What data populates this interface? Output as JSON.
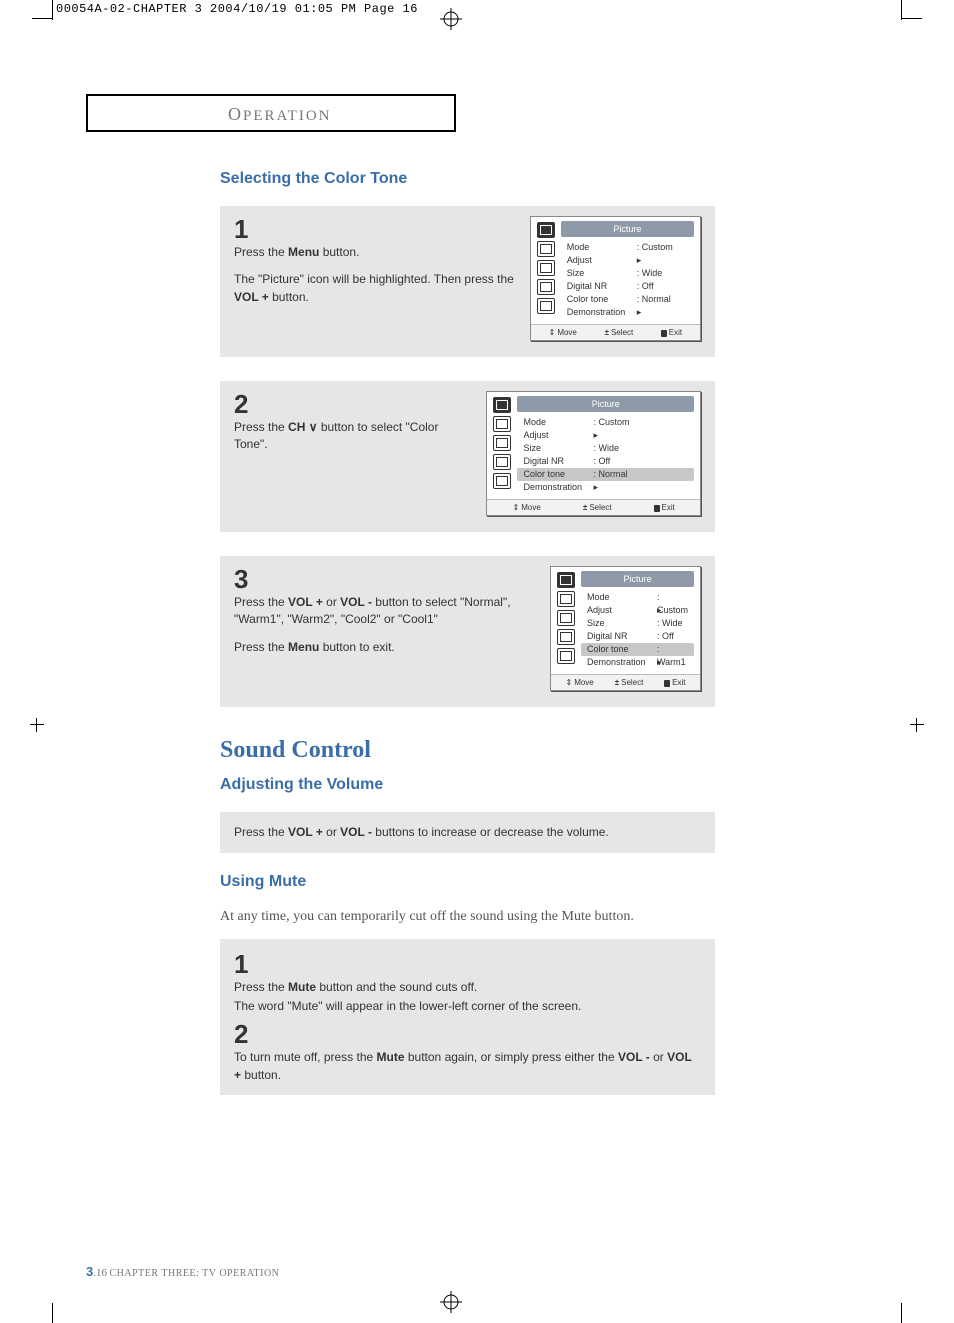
{
  "header_strip": "00054A-02-CHAPTER 3  2004/10/19  01:05 PM  Page 16",
  "section_tab": "OPERATION",
  "subhead1": "Selecting the Color Tone",
  "steps_color": [
    {
      "num": "1",
      "text_parts": [
        "Press the ",
        {
          "b": "Menu"
        },
        " button."
      ],
      "text2_parts": [
        "The \"Picture\" icon will be highlighted. Then press the ",
        {
          "b": "VOL +"
        },
        " button."
      ],
      "osd": {
        "title": "Picture",
        "highlight_index": -1,
        "rows": [
          {
            "k": "Mode",
            "v": ": Custom"
          },
          {
            "k": "Adjust",
            "v": "",
            "arrow": true
          },
          {
            "k": "Size",
            "v": ": Wide"
          },
          {
            "k": "Digital NR",
            "v": ": Off"
          },
          {
            "k": "Color tone",
            "v": ": Normal"
          },
          {
            "k": "Demonstration",
            "v": "",
            "arrow": true
          }
        ],
        "footer": {
          "move": "Move",
          "select": "Select",
          "exit": "Exit"
        }
      }
    },
    {
      "num": "2",
      "text_parts": [
        "Press the ",
        {
          "b": "CH ∨"
        },
        " button to select \"Color Tone\"."
      ],
      "osd": {
        "title": "Picture",
        "highlight_index": 4,
        "rows": [
          {
            "k": "Mode",
            "v": ": Custom"
          },
          {
            "k": "Adjust",
            "v": "",
            "arrow": true
          },
          {
            "k": "Size",
            "v": ": Wide"
          },
          {
            "k": "Digital NR",
            "v": ": Off"
          },
          {
            "k": "Color tone",
            "v": ": Normal"
          },
          {
            "k": "Demonstration",
            "v": "",
            "arrow": true
          }
        ],
        "footer": {
          "move": "Move",
          "select": "Select",
          "exit": "Exit"
        }
      }
    },
    {
      "num": "3",
      "text_parts": [
        "Press the ",
        {
          "b": "VOL +"
        },
        " or ",
        {
          "b": "VOL -"
        },
        " button to select \"Normal\", \"Warm1\", \"Warm2\", \"Cool2\" or \"Cool1\""
      ],
      "text2_parts": [
        "Press the ",
        {
          "b": "Menu"
        },
        " button to exit."
      ],
      "osd": {
        "title": "Picture",
        "highlight_index": 4,
        "rows": [
          {
            "k": "Mode",
            "v": ": Custom"
          },
          {
            "k": "Adjust",
            "v": "",
            "arrow": true
          },
          {
            "k": "Size",
            "v": ": Wide"
          },
          {
            "k": "Digital NR",
            "v": ": Off"
          },
          {
            "k": "Color tone",
            "v": ": Warm1"
          },
          {
            "k": "Demonstration",
            "v": "",
            "arrow": true
          }
        ],
        "footer": {
          "move": "Move",
          "select": "Select",
          "exit": "Exit"
        }
      }
    }
  ],
  "heading2": "Sound Control",
  "subhead2": "Adjusting the Volume",
  "volume_box_parts": [
    "Press the ",
    {
      "b": "VOL +"
    },
    " or ",
    {
      "b": "VOL -"
    },
    " buttons to increase or decrease the volume."
  ],
  "subhead3": "Using Mute",
  "mute_intro": "At any time, you can temporarily cut off the sound using the Mute button.",
  "mute_steps": [
    {
      "num": "1",
      "lines": [
        [
          "Press the ",
          {
            "b": "Mute"
          },
          " button and the sound cuts off."
        ],
        [
          "The word \"Mute\" will appear in the lower-left corner of the screen."
        ]
      ]
    },
    {
      "num": "2",
      "lines": [
        [
          "To turn mute off, press the ",
          {
            "b": "Mute"
          },
          " button again, or simply press either the ",
          {
            "b": "VOL -"
          },
          " or ",
          {
            "b": "VOL +"
          },
          " button."
        ]
      ]
    }
  ],
  "footer": {
    "chapter_num": "3",
    "page_num": ".16",
    "chapter_text": " CHAPTER THREE: TV OPERATION"
  }
}
